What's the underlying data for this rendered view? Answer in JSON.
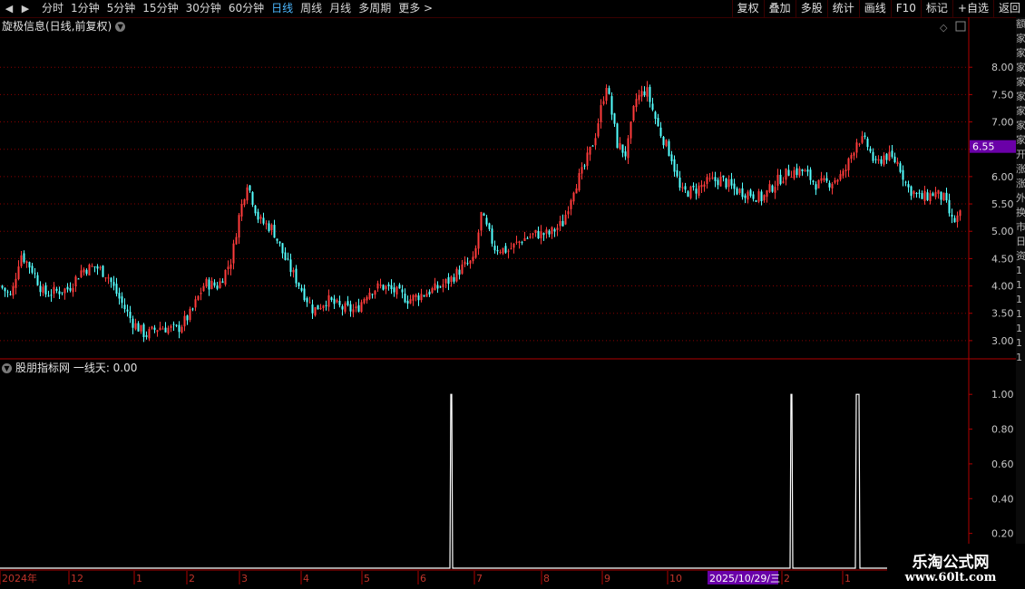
{
  "toolbar": {
    "periods": [
      "分时",
      "1分钟",
      "5分钟",
      "15分钟",
      "30分钟",
      "60分钟",
      "日线",
      "周线",
      "月线",
      "多周期",
      "更多 >"
    ],
    "active_period": "日线",
    "tools": [
      "复权",
      "叠加",
      "多股",
      "统计",
      "画线",
      "F10",
      "标记",
      "+自选",
      "返回"
    ]
  },
  "main_panel": {
    "title": "旋极信息(日线,前复权)",
    "price_tag": "6.55"
  },
  "sub_panel": {
    "title": "股朋指标网 一线天: 0.00"
  },
  "watermark": {
    "line1": "乐淘公式网",
    "line2": "www.60lt.com"
  },
  "right_strip_chars": [
    "额",
    "家",
    "家",
    "家",
    "家",
    "家",
    "家",
    "家",
    "家",
    "开",
    "涨",
    "涨",
    "外",
    "换",
    "市",
    "日",
    "资",
    "1",
    "1",
    "1",
    "1",
    "1",
    "1",
    "1"
  ],
  "colors": {
    "up": "#ff3b3b",
    "down": "#54ffff",
    "grid": "#8a0000",
    "axis": "#b00000",
    "text": "#c8c8c8",
    "highlight": "#6a00a8",
    "indicator": "#ffffff"
  },
  "chart_data": [
    {
      "type": "candlestick",
      "title": "旋极信息(日线,前复权)",
      "y_ticks": [
        3.0,
        3.5,
        4.0,
        4.5,
        5.0,
        5.5,
        6.0,
        6.5,
        7.0,
        7.5,
        8.0
      ],
      "y_tick_labels": [
        "3.00",
        "3.50",
        "4.00",
        "4.50",
        "5.00",
        "5.50",
        "6.00",
        "6.50",
        "7.00",
        "7.50",
        "8.00"
      ],
      "ylim": [
        2.7,
        8.6
      ],
      "current_price": 6.55,
      "close_path": [
        [
          0,
          4.0
        ],
        [
          12,
          3.8
        ],
        [
          22,
          4.6
        ],
        [
          35,
          4.3
        ],
        [
          48,
          3.85
        ],
        [
          62,
          3.9
        ],
        [
          75,
          3.95
        ],
        [
          90,
          4.3
        ],
        [
          105,
          4.35
        ],
        [
          118,
          4.2
        ],
        [
          130,
          3.8
        ],
        [
          145,
          3.35
        ],
        [
          160,
          3.1
        ],
        [
          175,
          3.25
        ],
        [
          195,
          3.2
        ],
        [
          210,
          3.5
        ],
        [
          225,
          4.05
        ],
        [
          240,
          4.0
        ],
        [
          255,
          4.5
        ],
        [
          262,
          5.2
        ],
        [
          272,
          5.9
        ],
        [
          285,
          5.2
        ],
        [
          300,
          5.05
        ],
        [
          315,
          4.45
        ],
        [
          330,
          4.0
        ],
        [
          345,
          3.55
        ],
        [
          360,
          3.75
        ],
        [
          375,
          3.6
        ],
        [
          392,
          3.55
        ],
        [
          405,
          3.9
        ],
        [
          420,
          4.0
        ],
        [
          435,
          3.9
        ],
        [
          450,
          3.75
        ],
        [
          465,
          3.85
        ],
        [
          480,
          3.95
        ],
        [
          495,
          4.1
        ],
        [
          510,
          4.35
        ],
        [
          522,
          4.45
        ],
        [
          530,
          5.3
        ],
        [
          545,
          4.7
        ],
        [
          560,
          4.65
        ],
        [
          575,
          4.85
        ],
        [
          590,
          4.95
        ],
        [
          605,
          4.95
        ],
        [
          620,
          5.15
        ],
        [
          632,
          5.8
        ],
        [
          642,
          6.1
        ],
        [
          655,
          6.7
        ],
        [
          668,
          7.7
        ],
        [
          680,
          6.6
        ],
        [
          690,
          6.4
        ],
        [
          700,
          7.4
        ],
        [
          712,
          7.6
        ],
        [
          725,
          6.9
        ],
        [
          740,
          6.35
        ],
        [
          750,
          5.7
        ],
        [
          765,
          5.75
        ],
        [
          780,
          5.9
        ],
        [
          795,
          5.95
        ],
        [
          810,
          5.75
        ],
        [
          825,
          5.7
        ],
        [
          840,
          5.6
        ],
        [
          855,
          5.9
        ],
        [
          870,
          6.1
        ],
        [
          885,
          6.1
        ],
        [
          900,
          5.85
        ],
        [
          915,
          5.9
        ],
        [
          930,
          6.05
        ],
        [
          945,
          6.7
        ],
        [
          955,
          6.6
        ],
        [
          965,
          6.2
        ],
        [
          975,
          6.4
        ],
        [
          990,
          6.25
        ],
        [
          1000,
          5.8
        ],
        [
          1015,
          5.6
        ],
        [
          1030,
          5.7
        ],
        [
          1040,
          5.6
        ],
        [
          1050,
          5.15
        ],
        [
          1058,
          5.3
        ]
      ],
      "type_note": "daily K-line, red up / cyan down"
    },
    {
      "type": "line",
      "title": "股朋指标网 一线天: 0.00",
      "series": [
        {
          "name": "一线天",
          "values": [
            0,
            1,
            0,
            1,
            0,
            1,
            0
          ]
        }
      ],
      "x_positions_data": [
        "2025-06 late",
        "2025-12/2026-01",
        "2026-01"
      ],
      "y_ticks": [
        0.2,
        0.4,
        0.6,
        0.8,
        1.0
      ],
      "y_tick_labels": [
        "0.20",
        "0.40",
        "0.60",
        "0.80",
        "1.00"
      ],
      "ylim": [
        0,
        1.1
      ],
      "spikes": [
        {
          "start": 496,
          "end": 498
        },
        {
          "start": 871,
          "end": 873
        },
        {
          "start": 943,
          "end": 947
        }
      ]
    }
  ],
  "x_axis": {
    "labels": [
      {
        "text": "2024年",
        "at": 2
      },
      {
        "text": "12",
        "at": 78
      },
      {
        "text": "1",
        "at": 150
      },
      {
        "text": "2",
        "at": 208
      },
      {
        "text": "3",
        "at": 266
      },
      {
        "text": "4",
        "at": 334
      },
      {
        "text": "5",
        "at": 401
      },
      {
        "text": "6",
        "at": 463
      },
      {
        "text": "7",
        "at": 525
      },
      {
        "text": "8",
        "at": 599
      },
      {
        "text": "9",
        "at": 666
      },
      {
        "text": "10",
        "at": 738
      },
      {
        "text": "2",
        "at": 864
      },
      {
        "text": "1",
        "at": 931
      }
    ],
    "highlight_label": "2025/10/29/三"
  }
}
